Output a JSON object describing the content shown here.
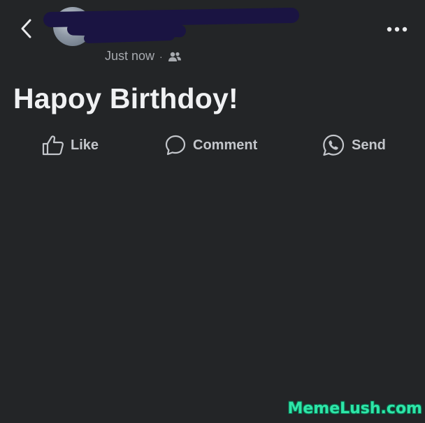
{
  "header": {
    "timestamp": "Just now",
    "separator": "·",
    "audience_icon": "friends-icon",
    "back_icon": "chevron-left-icon",
    "more_icon": "more-horizontal-icon"
  },
  "post": {
    "text": "Hapoy Birthdoy!"
  },
  "actions": {
    "like_label": "Like",
    "comment_label": "Comment",
    "send_label": "Send"
  },
  "watermark": {
    "text": "MemeLush.com"
  },
  "colors": {
    "background": "#232527",
    "text_primary": "#f0f1f3",
    "text_secondary": "#a8abb0",
    "redaction": "#1a1442",
    "watermark": "#2ee6a8"
  }
}
